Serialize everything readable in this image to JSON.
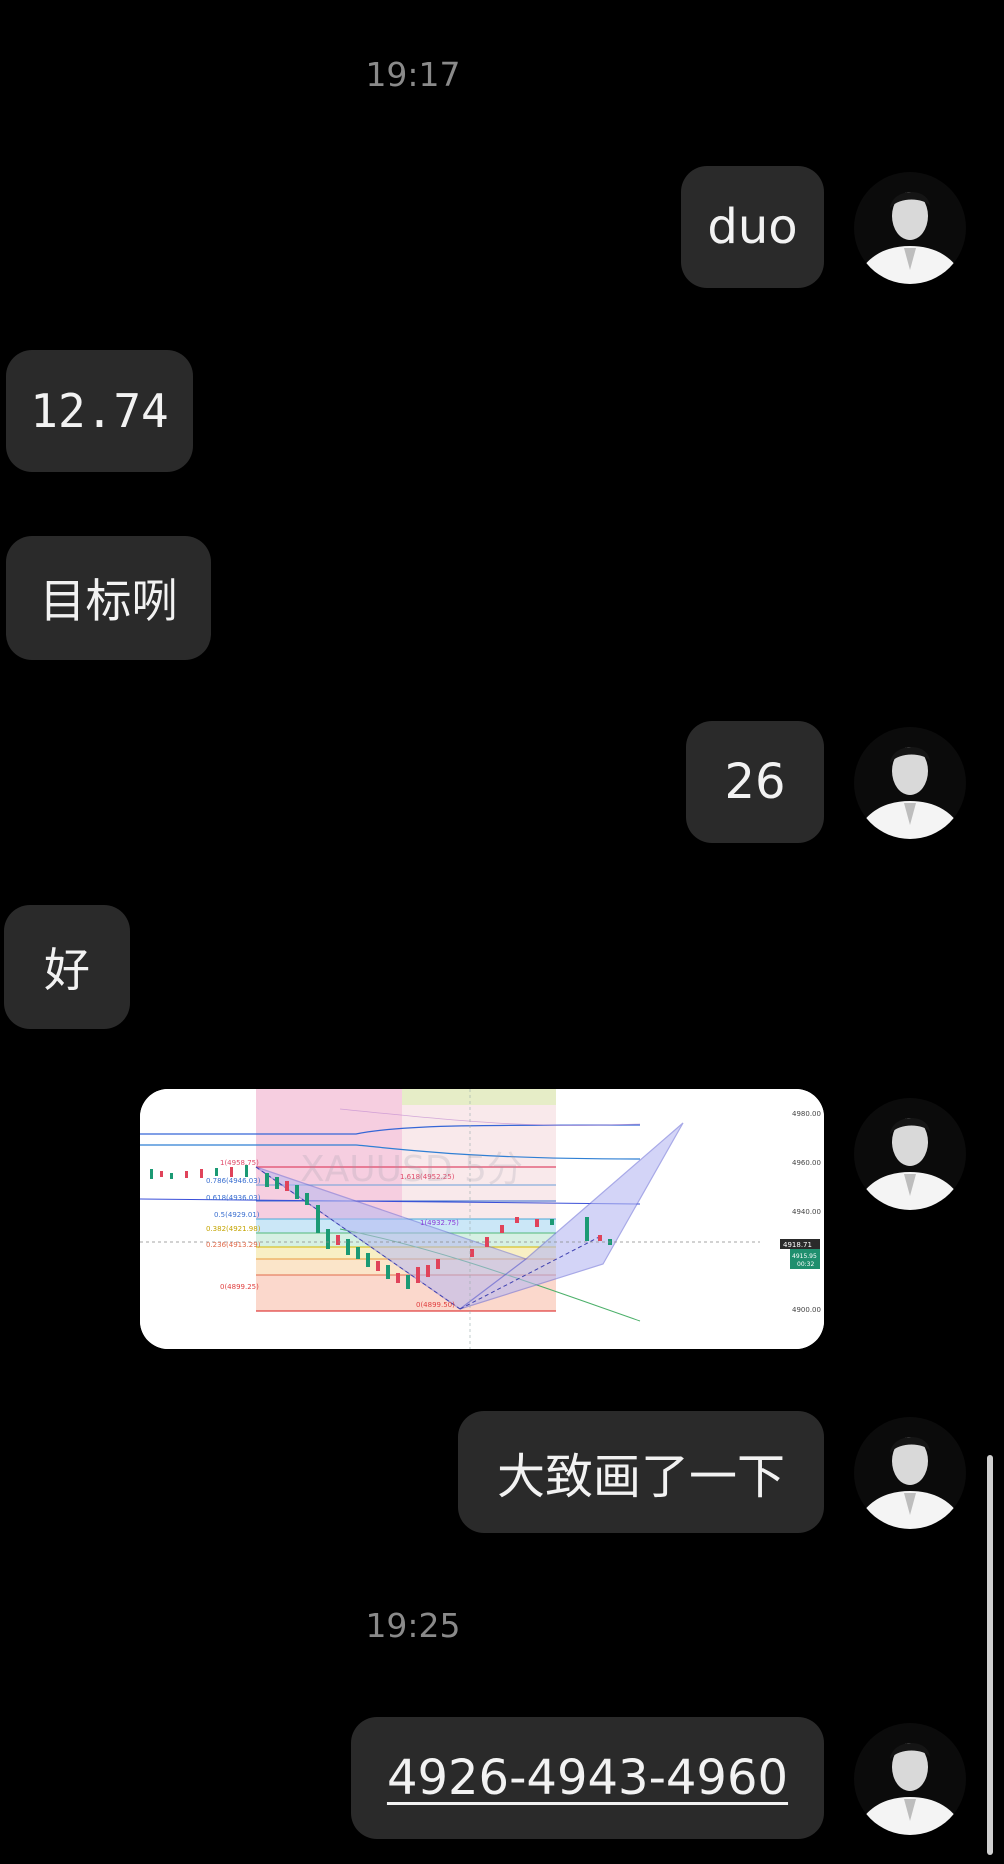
{
  "chat": {
    "timestamps": [
      "19:17",
      "19:25"
    ],
    "messages": [
      {
        "side": "right",
        "text": "duo"
      },
      {
        "side": "left",
        "text": "12.74"
      },
      {
        "side": "left",
        "text": "目标咧"
      },
      {
        "side": "right",
        "text": "26"
      },
      {
        "side": "left",
        "text": "好"
      },
      {
        "side": "right",
        "type": "image"
      },
      {
        "side": "right",
        "text": "大致画了一下"
      },
      {
        "side": "right",
        "text": "4926-4943-4960"
      }
    ]
  },
  "chart_image": {
    "fib_labels_left": [
      "1(4958.75)",
      "0.786(4946.03)",
      "0.618(4936.03)",
      "0.5(4929.01)",
      "0.382(4921.98)",
      "0.236(4913.29)",
      "0(4899.25)"
    ],
    "fib_labels_mid": [
      "1.618(4952.25)",
      "1(4932.75)",
      "0(4899.50)"
    ],
    "price_ticks": [
      "4980.00",
      "4960.00",
      "4940.00",
      "4900.00"
    ],
    "price_current": "4918.71",
    "price_box2": "4915.95",
    "timer": "00:32",
    "watermark": "XAUUSD 5分"
  },
  "colors": {
    "bubble": "#2a2a2a",
    "band_pink": "#f4c6da",
    "band_green": "#e6edc7",
    "harmonic_fill": "#b7b9f2",
    "price_tag_green": "#1f8f6e"
  }
}
